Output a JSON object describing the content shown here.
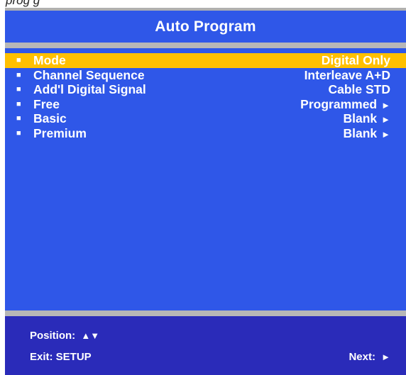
{
  "colors": {
    "panel_blue": "#2f57e8",
    "footer_blue": "#2a2bb9",
    "highlight_yellow": "#ffc000",
    "separator_gray": "#b7b7b7",
    "text_white": "#ffffff"
  },
  "header": {
    "cropped_caption": "prog       g",
    "title": "Auto Program"
  },
  "menu": {
    "bullet_glyph": "■",
    "items": [
      {
        "label": "Mode",
        "value": "Digital Only",
        "arrow": ""
      },
      {
        "label": "Channel Sequence",
        "value": "Interleave A+D",
        "arrow": ""
      },
      {
        "label": "Add'l Digital Signal",
        "value": "Cable STD",
        "arrow": ""
      },
      {
        "label": "Free",
        "value": "Programmed",
        "arrow": "►"
      },
      {
        "label": "Basic",
        "value": "Blank",
        "arrow": "►"
      },
      {
        "label": "Premium",
        "value": "Blank",
        "arrow": "►"
      }
    ],
    "selected_index": 0
  },
  "footer": {
    "position_label": "Position:",
    "position_symbols": "▲▼",
    "exit_label": "Exit: SETUP",
    "next_label": "Next:",
    "next_symbol": "►"
  }
}
